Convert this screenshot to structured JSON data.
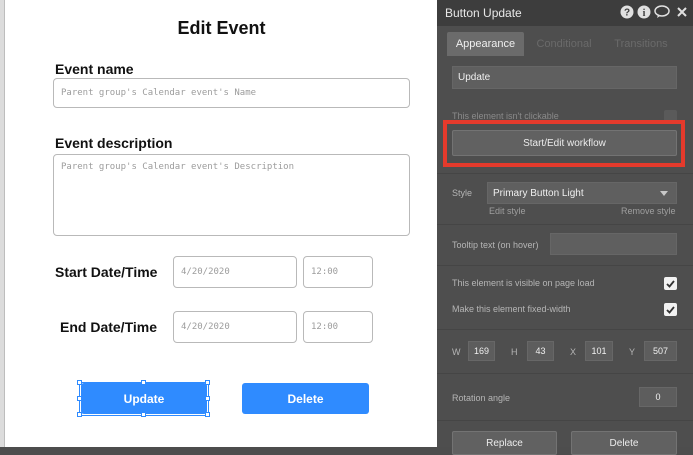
{
  "popup": {
    "title": "Edit Event",
    "event_name_label": "Event name",
    "event_name_placeholder": "Parent group's Calendar event's Name",
    "event_description_label": "Event description",
    "event_description_placeholder": "Parent group's Calendar event's Description",
    "start_label": "Start Date/Time",
    "start_date": "4/20/2020",
    "start_time": "12:00",
    "end_label": "End Date/Time",
    "end_date": "4/20/2020",
    "end_time": "12:00",
    "update_label": "Update",
    "delete_label": "Delete"
  },
  "panel": {
    "title": "Button Update",
    "header_icons": [
      "help-icon",
      "info-icon",
      "comment-icon",
      "close-icon"
    ],
    "tabs": [
      {
        "label": "Appearance",
        "active": true
      },
      {
        "label": "Conditional",
        "active": false
      },
      {
        "label": "Transitions",
        "active": false
      }
    ],
    "button_text_value": "Update",
    "not_clickable_label": "This element isn't clickable",
    "workflow_button_label": "Start/Edit workflow",
    "style_label": "Style",
    "style_value": "Primary Button Light",
    "edit_style_label": "Edit style",
    "remove_style_label": "Remove style",
    "tooltip_label": "Tooltip text (on hover)",
    "visible_on_load_label": "This element is visible on page load",
    "visible_on_load_checked": true,
    "fixed_width_label": "Make this element fixed-width",
    "fixed_width_checked": true,
    "dims": [
      {
        "label": "W",
        "value": "169"
      },
      {
        "label": "H",
        "value": "43"
      },
      {
        "label": "X",
        "value": "101"
      },
      {
        "label": "Y",
        "value": "507"
      }
    ],
    "rotation_label": "Rotation angle",
    "rotation_value": "0",
    "replace_label": "Replace",
    "delete_label": "Delete"
  },
  "colors": {
    "primary_blue": "#2f8bff",
    "highlight_red": "#e53a2c",
    "panel_bg": "#4e4e4e"
  }
}
